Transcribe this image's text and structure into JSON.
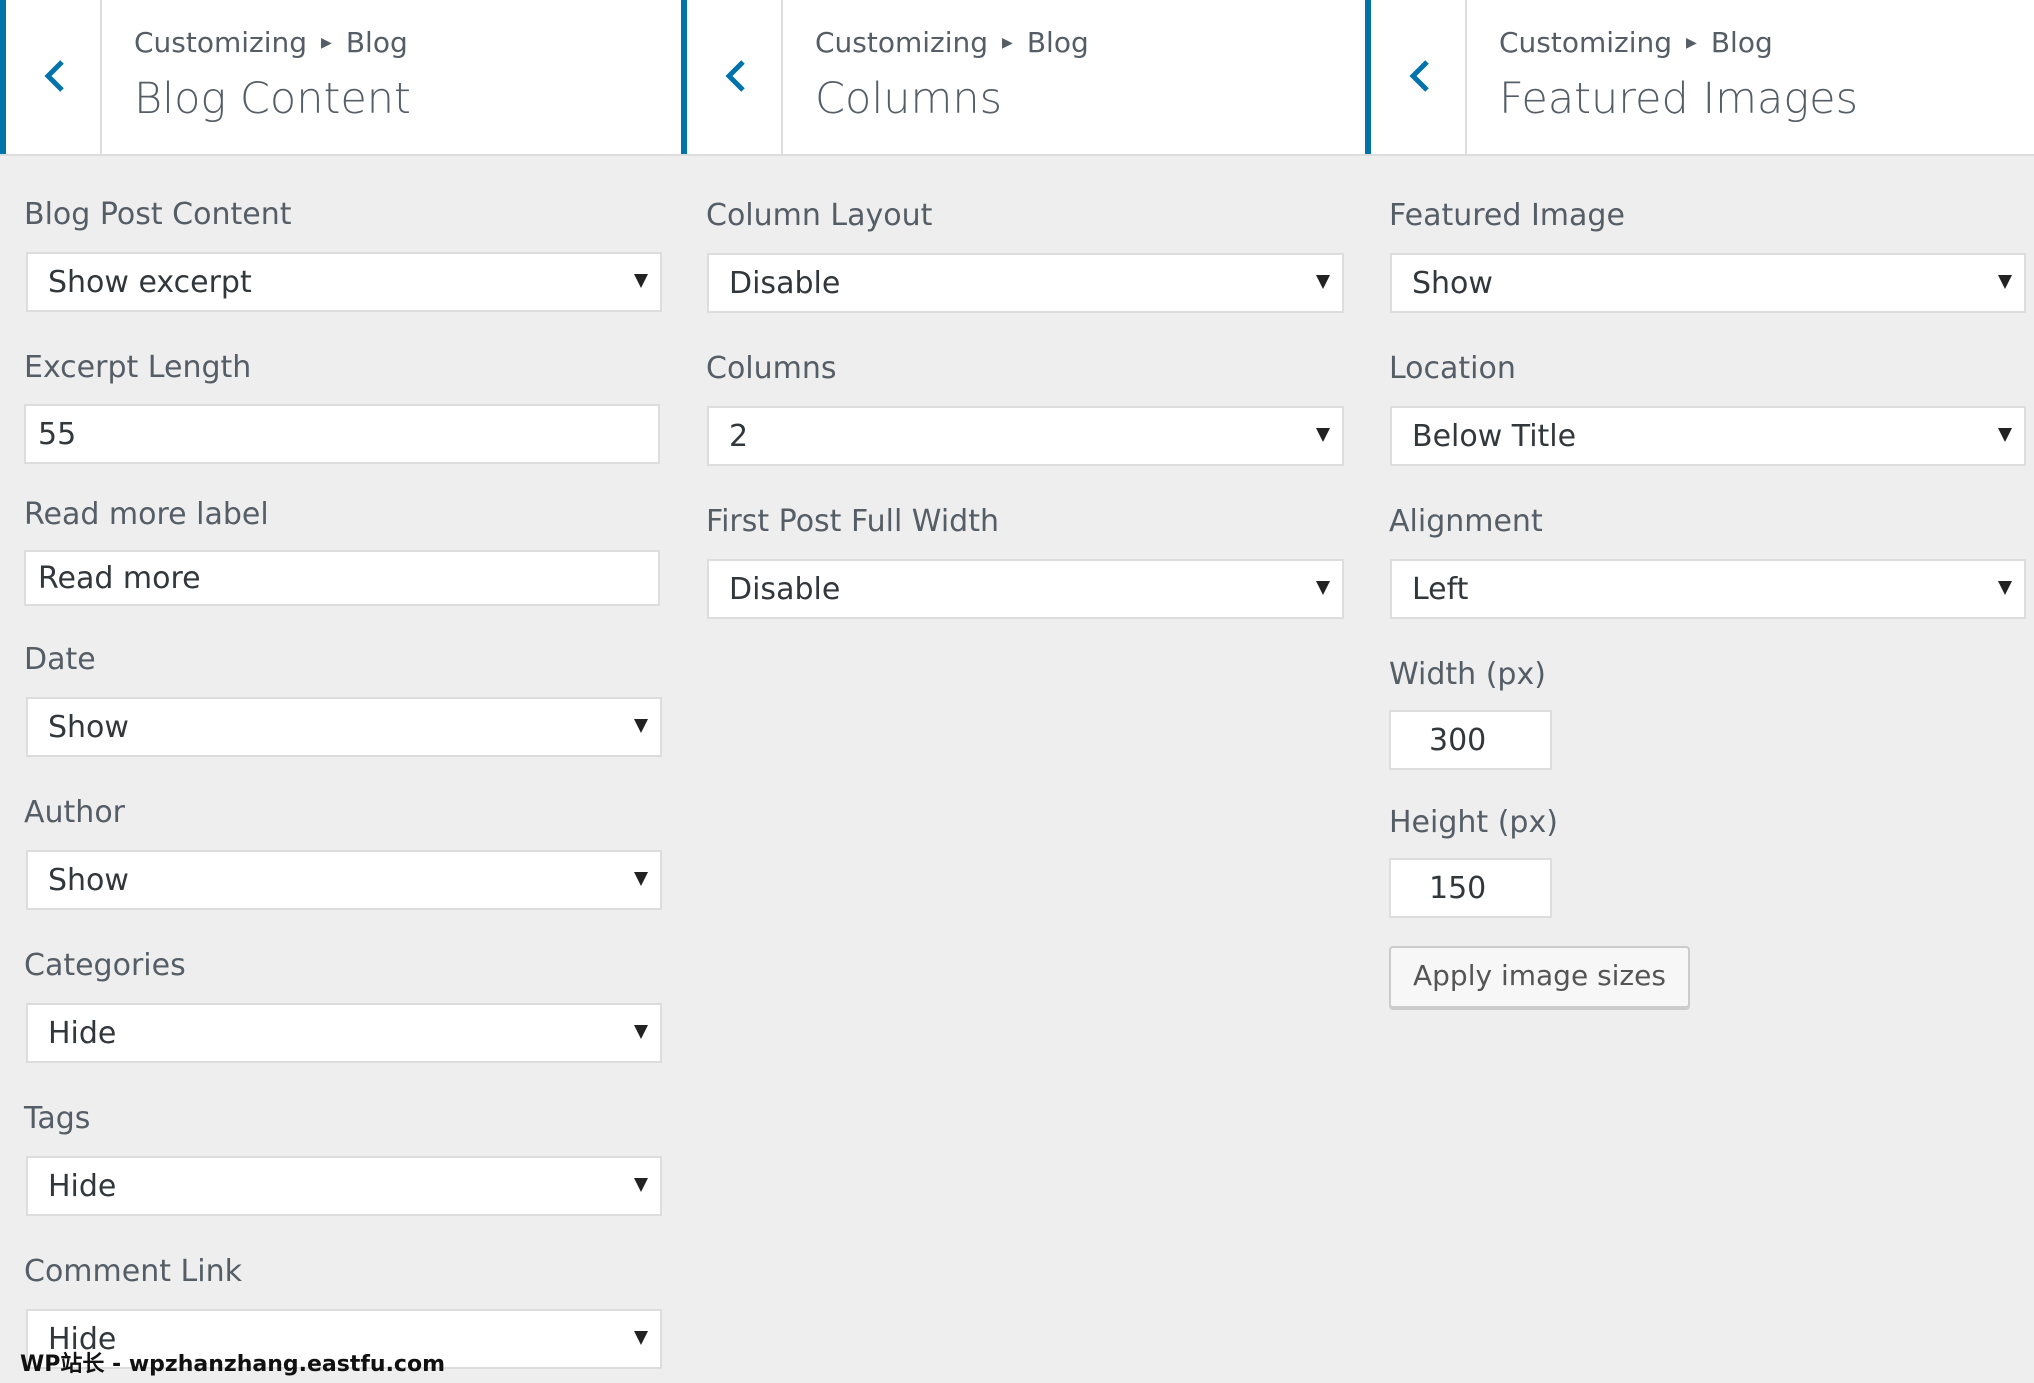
{
  "panels": [
    {
      "breadcrumb": {
        "root": "Customizing",
        "parent": "Blog"
      },
      "title": "Blog Content",
      "fields": {
        "post_content": {
          "label": "Blog Post Content",
          "value": "Show excerpt"
        },
        "excerpt_length": {
          "label": "Excerpt Length",
          "value": "55"
        },
        "read_more": {
          "label": "Read more label",
          "value": "Read more"
        },
        "date": {
          "label": "Date",
          "value": "Show"
        },
        "author": {
          "label": "Author",
          "value": "Show"
        },
        "categories": {
          "label": "Categories",
          "value": "Hide"
        },
        "tags": {
          "label": "Tags",
          "value": "Hide"
        },
        "comment_link": {
          "label": "Comment Link",
          "value": "Hide"
        }
      }
    },
    {
      "breadcrumb": {
        "root": "Customizing",
        "parent": "Blog"
      },
      "title": "Columns",
      "fields": {
        "column_layout": {
          "label": "Column Layout",
          "value": "Disable"
        },
        "columns": {
          "label": "Columns",
          "value": "2"
        },
        "first_post_full_width": {
          "label": "First Post Full Width",
          "value": "Disable"
        }
      }
    },
    {
      "breadcrumb": {
        "root": "Customizing",
        "parent": "Blog"
      },
      "title": "Featured Images",
      "fields": {
        "featured_image": {
          "label": "Featured Image",
          "value": "Show"
        },
        "location": {
          "label": "Location",
          "value": "Below Title"
        },
        "alignment": {
          "label": "Alignment",
          "value": "Left"
        },
        "width": {
          "label": "Width (px)",
          "value": "300"
        },
        "height": {
          "label": "Height (px)",
          "value": "150"
        }
      },
      "apply_button": "Apply image sizes"
    }
  ],
  "icons": {
    "back": "chevron-left-icon",
    "breadcrumb_separator": "triangle-right-icon",
    "select_arrow": "triangle-down-icon"
  },
  "colors": {
    "accent": "#0073aa",
    "background": "#eeeeee",
    "surface": "#ffffff",
    "border": "#dddddd",
    "label_text": "#555d66"
  },
  "watermark": "WP站长 - wpzhanzhang.eastfu.com"
}
